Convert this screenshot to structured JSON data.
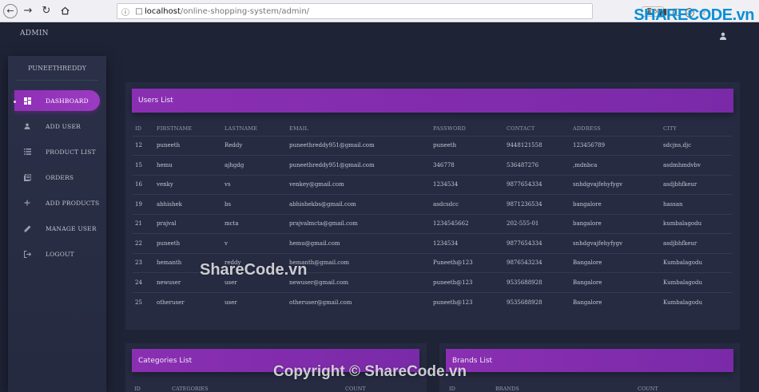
{
  "browser": {
    "url_host": "localhost",
    "url_path": "/online-shopping-system/admin/",
    "zoom": "90%",
    "watermark_logo": "SHARECODE.vn"
  },
  "header": {
    "title": "ADMIN"
  },
  "sidebar": {
    "username": "PUNEETHREDDY",
    "items": [
      {
        "label": "DASHBOARD",
        "icon": "dashboard-icon",
        "active": true
      },
      {
        "label": "ADD USER",
        "icon": "person-icon"
      },
      {
        "label": "PRODUCT LIST",
        "icon": "list-icon"
      },
      {
        "label": "ORDERS",
        "icon": "orders-icon"
      },
      {
        "label": "ADD PRODUCTS",
        "icon": "plus-icon"
      },
      {
        "label": "MANAGE USER",
        "icon": "edit-icon"
      },
      {
        "label": "LOGOUT",
        "icon": "logout-icon"
      }
    ]
  },
  "users_card": {
    "title": "Users List",
    "columns": [
      "ID",
      "FIRSTNAME",
      "LASTNAME",
      "EMAIL",
      "PASSWORD",
      "CONTACT",
      "ADDRESS",
      "CITY"
    ],
    "rows": [
      [
        "12",
        "puneeth",
        "Reddy",
        "puneethreddy951@gmail.com",
        "puneeth",
        "9448121558",
        "123456789",
        "sdcjns,djc"
      ],
      [
        "15",
        "hemu",
        "ajhgdg",
        "puneethreddy951@gmail.com",
        "346778",
        "536487276",
        ",mdnbca",
        "asdmhmdvbv"
      ],
      [
        "16",
        "venky",
        "vs",
        "venkey@gmail.com",
        "1234534",
        "9877654334",
        "snhdgvajfehyfygv",
        "asdjbhfkeur"
      ],
      [
        "19",
        "abhishek",
        "bs",
        "abhishekbs@gmail.com",
        "asdcsdcc",
        "9871236534",
        "bangalore",
        "hassan"
      ],
      [
        "21",
        "prajval",
        "mcta",
        "prajvalmcta@gmail.com",
        "1234545662",
        "202-555-01",
        "bangalore",
        "kumbalagodu"
      ],
      [
        "22",
        "puneeth",
        "v",
        "hemu@gmail.com",
        "1234534",
        "9877654334",
        "snhdgvajfehyfygv",
        "asdjbhfkeur"
      ],
      [
        "23",
        "hemanth",
        "reddy",
        "hemanth@gmail.com",
        "Puneeth@123",
        "9876543234",
        "Bangalore",
        "Kumbalagodu"
      ],
      [
        "24",
        "newuser",
        "user",
        "newuser@gmail.com",
        "puneeth@123",
        "9535688928",
        "Bangalore",
        "Kumbalagodu"
      ],
      [
        "25",
        "otheruser",
        "user",
        "otheruser@gmail.com",
        "puneeth@123",
        "9535688928",
        "Bangalore",
        "Kumbalagodu"
      ]
    ]
  },
  "categories_card": {
    "title": "Categories List",
    "columns": [
      "ID",
      "CATEGORIES",
      "COUNT"
    ]
  },
  "brands_card": {
    "title": "Brands List",
    "columns": [
      "ID",
      "BRANDS",
      "COUNT"
    ]
  },
  "watermarks": {
    "center": "ShareCode.vn",
    "bottom": "Copyright © ShareCode.vn"
  },
  "colors": {
    "accent": "#8a2fb2",
    "background": "#1f2336",
    "card": "#262b42"
  }
}
